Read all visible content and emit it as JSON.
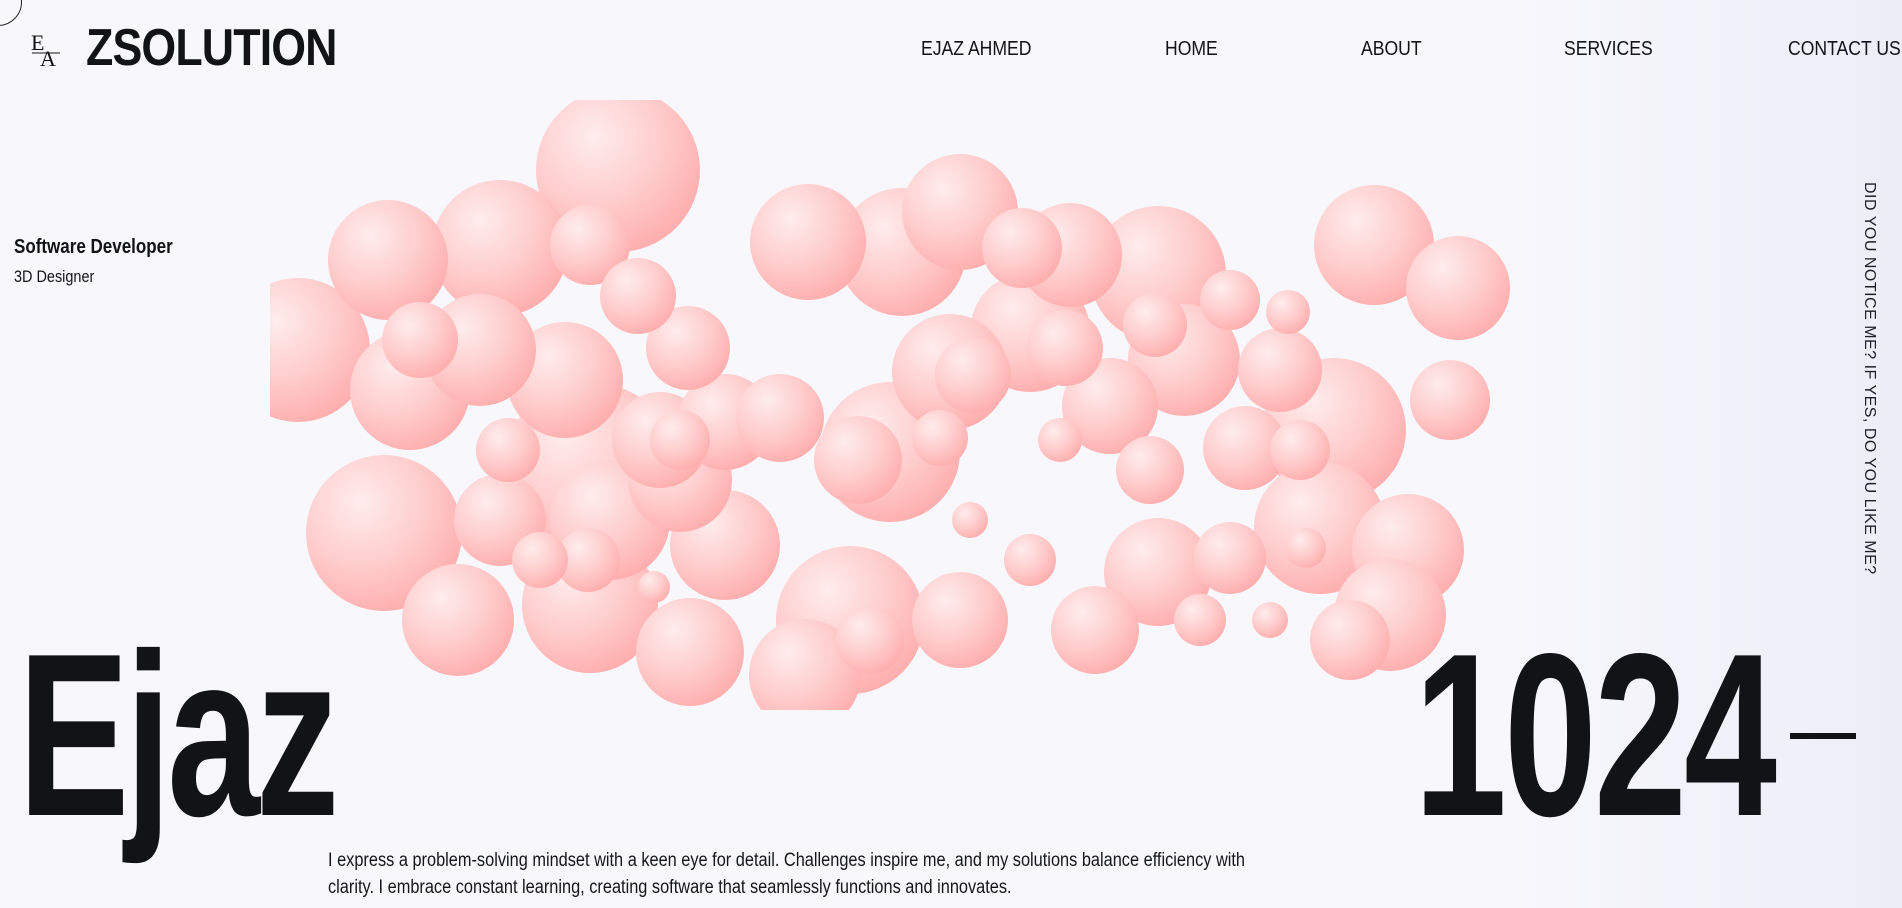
{
  "brand": {
    "logo_text": "EA",
    "name": "ZSOLUTION"
  },
  "nav": {
    "items": [
      {
        "label": "EJAZ AHMED"
      },
      {
        "label": "HOME"
      },
      {
        "label": "ABOUT"
      },
      {
        "label": "SERVICES"
      },
      {
        "label": "CONTACT US"
      }
    ]
  },
  "hero": {
    "role_title": "Software Developer",
    "role_subtitle": "3D Designer",
    "side_text": "DID YOU NOTICE ME? IF YES, DO YOU LIKE ME?",
    "big_name": "Ejaz",
    "big_number": "1024",
    "bio": "I express a problem-solving mindset with a keen eye for detail. Challenges inspire me, and my solutions balance efficiency with clarity. I embrace constant learning, creating software that seamlessly functions and innovates."
  },
  "colors": {
    "sphere_light": "#ffe6e6",
    "sphere_mid": "#ffc4c4",
    "sphere_dark": "#ffaaaa",
    "text": "#121316"
  },
  "icons": {
    "cursor": "cursor-ring-icon",
    "logo": "ea-monogram-icon"
  }
}
